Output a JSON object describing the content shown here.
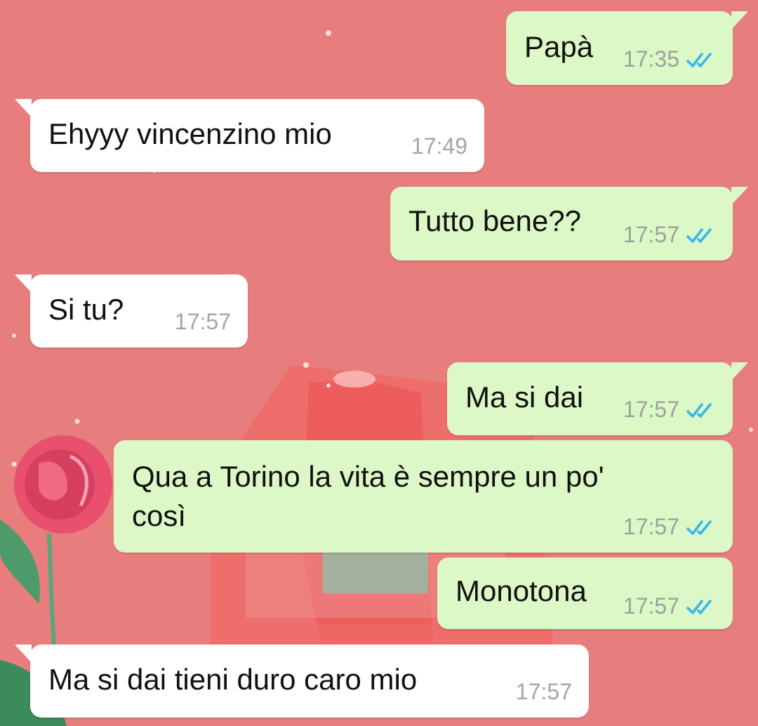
{
  "chat": {
    "background_color": "#e87d7e",
    "outgoing_bubble_color": "#dcf8c6",
    "incoming_bubble_color": "#ffffff",
    "read_tick_color": "#34b7f1",
    "messages": [
      {
        "direction": "out",
        "text": "Papà",
        "time": "17:35",
        "status": "read"
      },
      {
        "direction": "in",
        "text": "Ehyyy vincenzino mio",
        "time": "17:49"
      },
      {
        "direction": "out",
        "text": "Tutto bene??",
        "time": "17:57",
        "status": "read"
      },
      {
        "direction": "in",
        "text": "Si tu?",
        "time": "17:57"
      },
      {
        "direction": "out",
        "text": "Ma si dai",
        "time": "17:57",
        "status": "read"
      },
      {
        "direction": "out",
        "text": "Qua a Torino la vita è sempre un po'\ncosì",
        "time": "17:57",
        "status": "read"
      },
      {
        "direction": "out",
        "text": "Monotona",
        "time": "17:57",
        "status": "read"
      },
      {
        "direction": "in",
        "text": "Ma si dai tieni duro caro mio",
        "time": "17:57"
      }
    ]
  }
}
